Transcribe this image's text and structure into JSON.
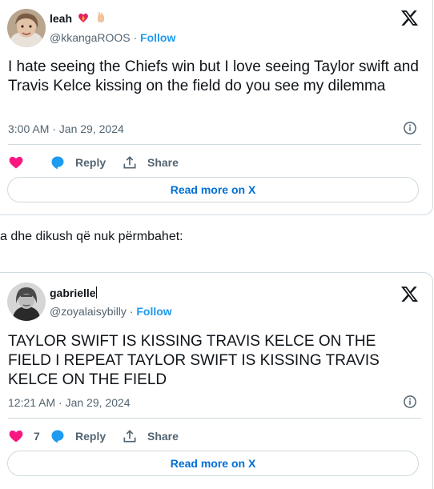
{
  "tweets": [
    {
      "name": "leah",
      "name_emojis": [
        "heart-on-fire",
        "hand-emoji"
      ],
      "handle": "@kkangaROOS",
      "separator": " · ",
      "follow_label": "Follow",
      "text": "I hate seeing the Chiefs win but I love seeing Taylor swift and Travis Kelce kissing on the field do you see my dilemma",
      "timestamp": "3:00 AM · Jan 29, 2024",
      "like_count": "",
      "reply_label": "Reply",
      "share_label": "Share",
      "read_more_label": "Read more on X"
    },
    {
      "name": "gabrielle",
      "handle": "@zoyalaisybilly",
      "separator": " · ",
      "follow_label": "Follow",
      "text": "TAYLOR SWIFT IS KISSING TRAVIS KELCE ON THE FIELD I REPEAT TAYLOR SWIFT IS KISSING TRAVIS KELCE ON THE FIELD",
      "timestamp": "12:21 AM · Jan 29, 2024",
      "like_count": "7",
      "reply_label": "Reply",
      "share_label": "Share",
      "read_more_label": "Read more on X"
    }
  ],
  "between_text": "a dhe dikush që nuk përmbahet:",
  "colors": {
    "like": "#f91880",
    "reply": "#1d9bf0",
    "link": "#006fd6",
    "follow": "#1d9bf0",
    "muted": "#536471",
    "border": "#cfd9de"
  },
  "icons": [
    "x-logo-icon",
    "info-icon",
    "heart-icon",
    "reply-bubble-icon",
    "share-icon"
  ]
}
